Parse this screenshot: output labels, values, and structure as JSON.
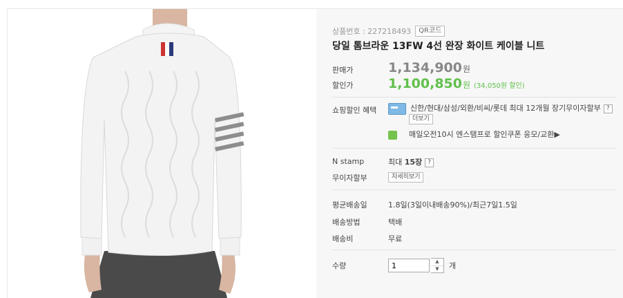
{
  "product": {
    "number_label": "상품번호 : 227218493",
    "qr_label": "QR코드",
    "title": "당일 톰브라운 13FW 4선 완장 화이트 케이블 니트"
  },
  "price": {
    "list_label": "판매가",
    "list_value": "1,134,900",
    "won": "원",
    "sale_label": "할인가",
    "sale_value": "1,100,850",
    "sale_won": "원",
    "sale_note": "(34,050원 할인)"
  },
  "benefit": {
    "label": "쇼핑할인 혜택",
    "card_text": "신한/현대/삼성/외환/비씨/롯데 최대 12개월 장기무이자할부",
    "more_label": "더보기",
    "coupon_text": "매일오전10시 엔스탬프로 할인쿠폰 응모/교환▶"
  },
  "stamp": {
    "label": "N stamp",
    "value_prefix": "최대",
    "value": "15장"
  },
  "installment": {
    "label": "무이자할부",
    "button": "자세히보기"
  },
  "shipping": {
    "avg_label": "평균배송일",
    "avg_value": "1.8일(3일이내배송90%)/최근7일1.5일",
    "method_label": "배송방법",
    "method_value": "택배",
    "fee_label": "배송비",
    "fee_value": "무료"
  },
  "quantity": {
    "label": "수량",
    "value": "1",
    "unit": "개",
    "up": "▲",
    "down": "▼"
  },
  "help_mark": "?",
  "colors": {
    "sale_green": "#5fc04a",
    "panel_bg": "#f7f7f7"
  }
}
